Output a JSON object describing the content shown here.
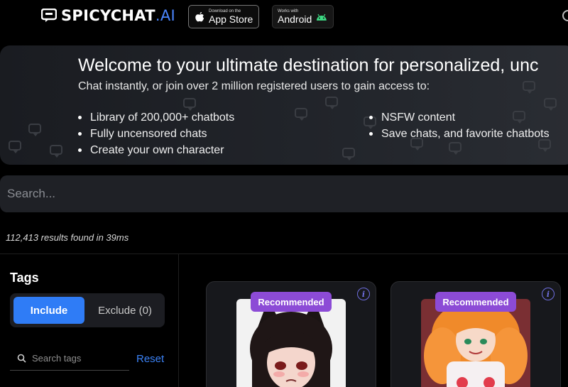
{
  "header": {
    "logo_brand": "SPICYCHAT",
    "logo_tld": ".AI",
    "app_store": {
      "small": "Download on the",
      "big": "App Store"
    },
    "android": {
      "small": "Works with",
      "big": "Android"
    }
  },
  "banner": {
    "title": "Welcome to your ultimate destination for personalized, unc",
    "subtitle": "Chat instantly, or join over 2 million registered users to gain access to:",
    "features_left": [
      "Library of 200,000+ chatbots",
      "Fully uncensored chats",
      "Create your own character"
    ],
    "features_right": [
      "NSFW content",
      "Save chats, and favorite chatbots"
    ]
  },
  "search": {
    "placeholder": "Search..."
  },
  "results_text": "112,413 results found in 39ms",
  "tags": {
    "title": "Tags",
    "include_label": "Include",
    "exclude_label": "Exclude (0)",
    "search_placeholder": "Search tags",
    "reset_label": "Reset"
  },
  "cards": [
    {
      "badge": "Recommended",
      "info": "i"
    },
    {
      "badge": "Recommended",
      "info": "i"
    }
  ],
  "colors": {
    "accent_blue": "#2f7cf6",
    "badge_purple": "#8c4bd6",
    "link_blue": "#3b82f6",
    "background": "#000000"
  }
}
